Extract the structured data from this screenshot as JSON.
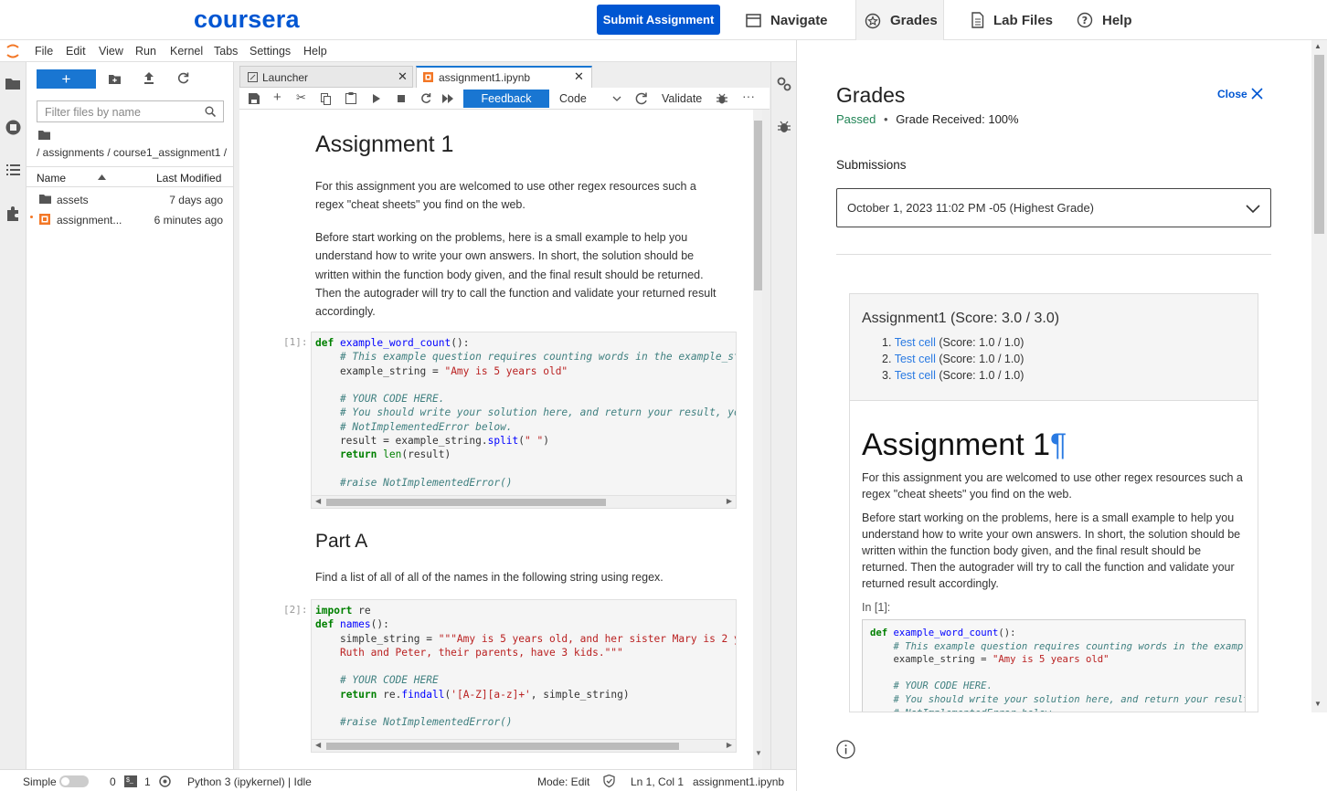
{
  "header": {
    "logo": "coursera",
    "submit_label": "Submit Assignment",
    "nav": [
      "Navigate",
      "Grades",
      "Lab Files",
      "Help"
    ]
  },
  "menu": [
    "File",
    "Edit",
    "View",
    "Run",
    "Kernel",
    "Tabs",
    "Settings",
    "Help"
  ],
  "filebrowser": {
    "new_label": "+",
    "filter_placeholder": "Filter files by name",
    "breadcrumb": "/ assignments / course1_assignment1 /",
    "col_name": "Name",
    "col_modified": "Last Modified",
    "files": [
      {
        "name": "assets",
        "modified": "7 days ago"
      },
      {
        "name": "assignment...",
        "modified": "6 minutes ago"
      }
    ]
  },
  "tabs": {
    "launcher": "Launcher",
    "notebook": "assignment1.ipynb"
  },
  "toolbar": {
    "feedback": "Feedback",
    "celltype": "Code",
    "validate": "Validate"
  },
  "notebook": {
    "title": "Assignment 1",
    "p1": "For this assignment you are welcomed to use other regex resources such a regex \"cheat sheets\" you find on the web.",
    "p2": "Before start working on the problems, here is a small example to help you understand how to write your own answers. In short, the solution should be written within the function body given, and the final result should be returned. Then the autograder will try to call the function and validate your returned result accordingly.",
    "prompt1": "[1]:",
    "part_a": "Part A",
    "p3": "Find a list of all of all of the names in the following string using regex.",
    "prompt2": "[2]:"
  },
  "status": {
    "mode_simple": "Simple",
    "count0": "0",
    "count1": "1",
    "kernel": "Python 3 (ipykernel) | Idle",
    "mode": "Mode: Edit",
    "position": "Ln 1, Col 1",
    "file": "assignment1.ipynb"
  },
  "grades": {
    "title": "Grades",
    "close": "Close",
    "status": "Passed",
    "grade": "Grade Received: 100%",
    "submissions_label": "Submissions",
    "selected_submission": "October 1, 2023 11:02 PM -05 (Highest Grade)",
    "report_title": "Assignment1 (Score: 3.0 / 3.0)",
    "tests": [
      {
        "num": "1.",
        "link": "Test cell",
        "score": "(Score: 1.0 / 1.0)"
      },
      {
        "num": "2.",
        "link": "Test cell",
        "score": "(Score: 1.0 / 1.0)"
      },
      {
        "num": "3.",
        "link": "Test cell",
        "score": "(Score: 1.0 / 1.0)"
      }
    ],
    "heading": "Assignment 1",
    "pilcrow": "¶",
    "p1": "For this assignment you are welcomed to use other regex resources such a regex \"cheat sheets\" you find on the web.",
    "p2": "Before start working on the problems, here is a small example to help you understand how to write your own answers. In short, the solution should be written within the function body given, and the final result should be returned. Then the autograder will try to call the function and validate your returned result accordingly.",
    "in_prompt": "In [1]:"
  },
  "colors": {
    "brand": "#0056d2",
    "jupyter_blue": "#1976d2",
    "passed": "#1f8354",
    "link": "#2a7ae2"
  }
}
